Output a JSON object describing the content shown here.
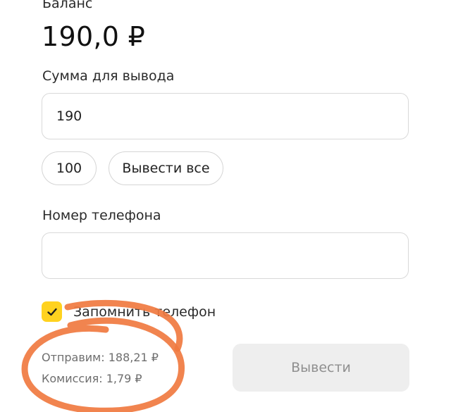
{
  "balance": {
    "label": "Баланс",
    "value": "190,0 ₽"
  },
  "amount": {
    "label": "Сумма для вывода",
    "value": "190",
    "presets": [
      "100",
      "Вывести все"
    ]
  },
  "phone": {
    "label": "Номер телефона",
    "value": "",
    "placeholder": ""
  },
  "remember_phone": {
    "checked": true,
    "label": "Запомнить телефон"
  },
  "summary": {
    "send": "Отправим: 188,21 ₽",
    "fee": "Комиссия: 1,79 ₽"
  },
  "submit": {
    "label": "Вывести"
  },
  "colors": {
    "checkbox": "#ffd21f",
    "annotation": "#f07a40",
    "button_disabled_bg": "#eeeeee"
  }
}
